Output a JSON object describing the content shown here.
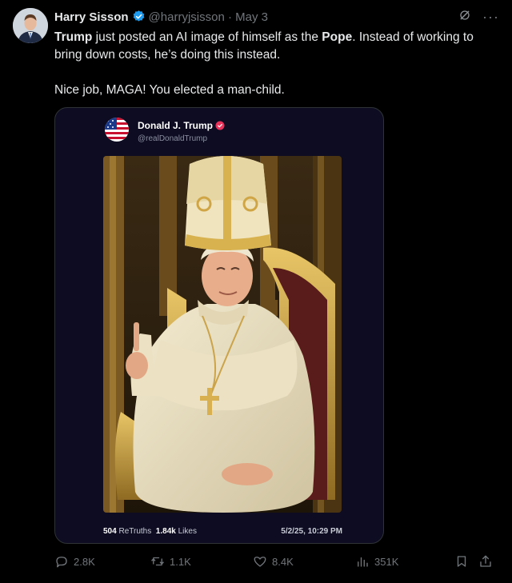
{
  "author": {
    "name": "Harry Sisson",
    "handle": "@harryjsisson",
    "separator": "·",
    "date": "May 3"
  },
  "tweet": {
    "line1_bold_1": "Trump",
    "line1_text_1": " just posted an AI image of himself as the ",
    "line1_bold_2": "Pope",
    "line1_text_2": ". Instead of working to bring down costs, he’s doing this instead.",
    "line2": "Nice job, MAGA! You elected a man-child."
  },
  "embed": {
    "name": "Donald J. Trump",
    "handle": "@realDonaldTrump",
    "retruths_count": "504",
    "retruths_label": "ReTruths",
    "likes_count": "1.84k",
    "likes_label": "Likes",
    "timestamp": "5/2/25, 10:29 PM",
    "image_icon": "pope-portrait-image"
  },
  "actions": {
    "replies": "2.8K",
    "reposts": "1.1K",
    "likes": "8.4K",
    "views": "351K"
  },
  "icons": [
    "verified-badge-icon",
    "grok-icon",
    "more-icon",
    "reply-icon",
    "repost-icon",
    "like-icon",
    "views-icon",
    "bookmark-icon",
    "share-icon"
  ],
  "colors": {
    "background": "#000000",
    "text": "#e7e9ea",
    "muted": "#71767b",
    "verified": "#1d9bf0",
    "embed_bg": "#0d0c22"
  }
}
